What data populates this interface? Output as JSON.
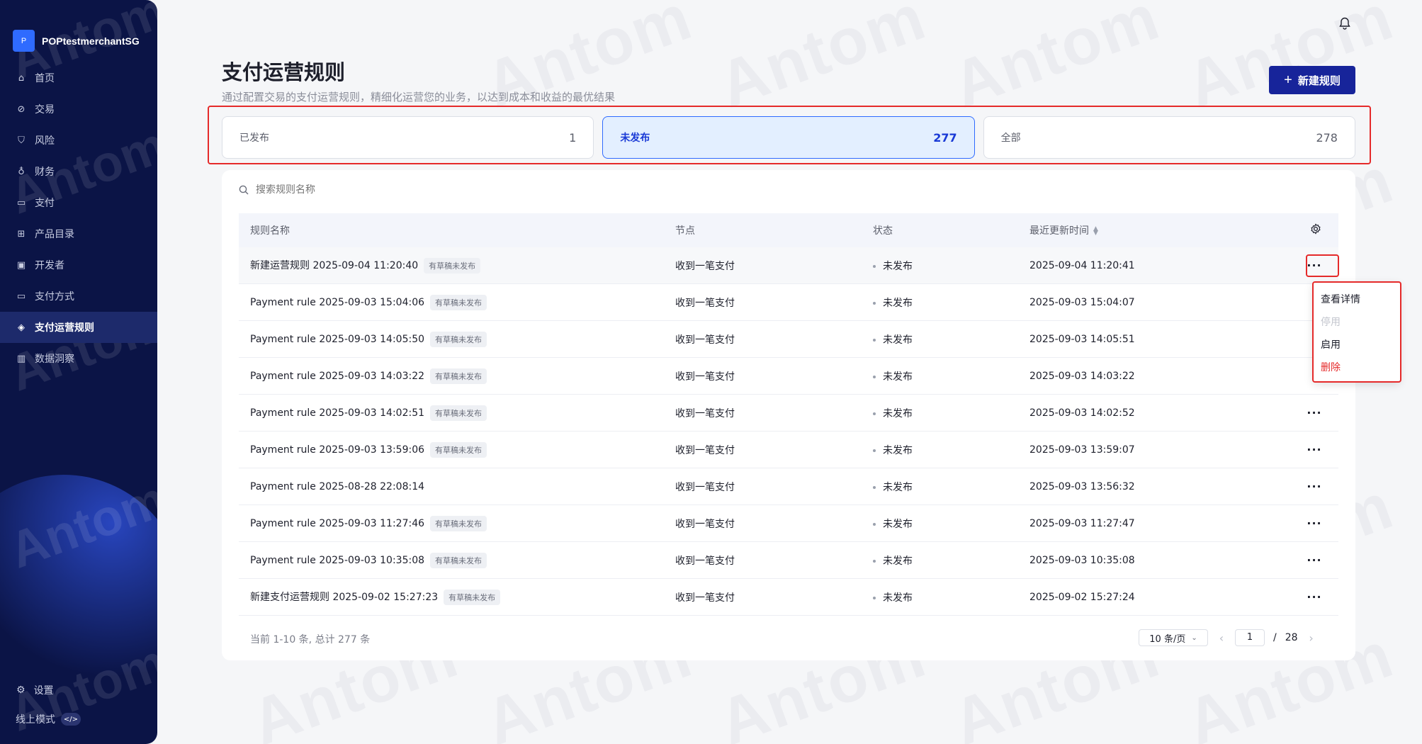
{
  "sidebar": {
    "merchant_name": "POPtestmerchantSG",
    "merchant_logo": "P",
    "items": [
      {
        "label": "首页",
        "icon": "home-icon",
        "active": false
      },
      {
        "label": "交易",
        "icon": "transaction-icon",
        "active": false
      },
      {
        "label": "风险",
        "icon": "shield-icon",
        "active": false
      },
      {
        "label": "财务",
        "icon": "finance-icon",
        "active": false
      },
      {
        "label": "支付",
        "icon": "wallet-icon",
        "active": false
      },
      {
        "label": "产品目录",
        "icon": "grid-icon",
        "active": false
      },
      {
        "label": "开发者",
        "icon": "code-icon",
        "active": false
      },
      {
        "label": "支付方式",
        "icon": "card-icon",
        "active": false
      },
      {
        "label": "支付运营规则",
        "icon": "rule-icon",
        "active": true
      },
      {
        "label": "数据洞察",
        "icon": "chart-icon",
        "active": false
      }
    ],
    "settings_label": "设置",
    "mode_label": "线上模式",
    "mode_toggle": "</>"
  },
  "header": {
    "title": "支付运营规则",
    "subtitle": "通过配置交易的支付运营规则，精细化运营您的业务，以达到成本和收益的最优结果",
    "new_button": "新建规则"
  },
  "stats": [
    {
      "label": "已发布",
      "count": "1"
    },
    {
      "label": "未发布",
      "count": "277",
      "active": true
    },
    {
      "label": "全部",
      "count": "278"
    }
  ],
  "search": {
    "placeholder": "搜索规则名称"
  },
  "table": {
    "columns": [
      "规则名称",
      "节点",
      "状态",
      "最近更新时间"
    ],
    "rows": [
      {
        "name": "新建运营规则 2025-09-04 11:20:40",
        "badge": "有草稿未发布",
        "node": "收到一笔支付",
        "status": "未发布",
        "updated": "2025-09-04 11:20:41"
      },
      {
        "name": "Payment rule 2025-09-03 15:04:06",
        "badge": "有草稿未发布",
        "node": "收到一笔支付",
        "status": "未发布",
        "updated": "2025-09-03 15:04:07"
      },
      {
        "name": "Payment rule 2025-09-03 14:05:50",
        "badge": "有草稿未发布",
        "node": "收到一笔支付",
        "status": "未发布",
        "updated": "2025-09-03 14:05:51"
      },
      {
        "name": "Payment rule 2025-09-03 14:03:22",
        "badge": "有草稿未发布",
        "node": "收到一笔支付",
        "status": "未发布",
        "updated": "2025-09-03 14:03:22"
      },
      {
        "name": "Payment rule 2025-09-03 14:02:51",
        "badge": "有草稿未发布",
        "node": "收到一笔支付",
        "status": "未发布",
        "updated": "2025-09-03 14:02:52"
      },
      {
        "name": "Payment rule 2025-09-03 13:59:06",
        "badge": "有草稿未发布",
        "node": "收到一笔支付",
        "status": "未发布",
        "updated": "2025-09-03 13:59:07"
      },
      {
        "name": "Payment rule 2025-08-28 22:08:14",
        "badge": "",
        "node": "收到一笔支付",
        "status": "未发布",
        "updated": "2025-09-03 13:56:32"
      },
      {
        "name": "Payment rule 2025-09-03 11:27:46",
        "badge": "有草稿未发布",
        "node": "收到一笔支付",
        "status": "未发布",
        "updated": "2025-09-03 11:27:47"
      },
      {
        "name": "Payment rule 2025-09-03 10:35:08",
        "badge": "有草稿未发布",
        "node": "收到一笔支付",
        "status": "未发布",
        "updated": "2025-09-03 10:35:08"
      },
      {
        "name": "新建支付运营规则 2025-09-02 15:27:23",
        "badge": "有草稿未发布",
        "node": "收到一笔支付",
        "status": "未发布",
        "updated": "2025-09-02 15:27:24"
      }
    ]
  },
  "dropdown": {
    "items": [
      {
        "label": "查看详情",
        "kind": "normal"
      },
      {
        "label": "停用",
        "kind": "disabled"
      },
      {
        "label": "启用",
        "kind": "normal"
      },
      {
        "label": "删除",
        "kind": "danger"
      }
    ]
  },
  "pagination": {
    "total_text": "当前 1-10 条, 总计 277 条",
    "page_size": "10 条/页",
    "current_page": "1",
    "separator": "/",
    "total_pages": "28"
  },
  "watermark_text": "Antom",
  "colors": {
    "sidebar_bg": "#0b1446",
    "primary": "#17249a",
    "active_card_bg": "#e3efff",
    "highlight": "#e52a2a"
  }
}
